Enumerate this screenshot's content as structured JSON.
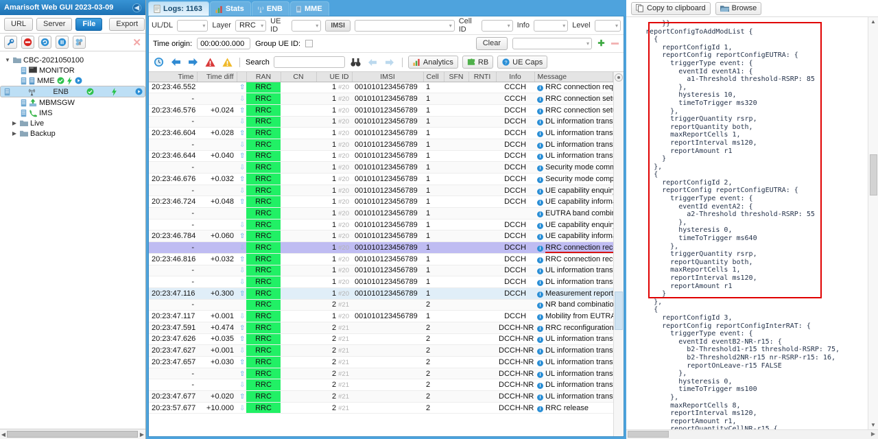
{
  "left_panel": {
    "title": "Amarisoft Web GUI 2023-03-09",
    "collapse_icon": "chevron-left-icon",
    "source_buttons": [
      {
        "label": "URL",
        "active": false
      },
      {
        "label": "Server",
        "active": false
      },
      {
        "label": "File",
        "active": true
      }
    ],
    "export_label": "Export",
    "tools": [
      "wrench-icon",
      "stop-icon",
      "refresh-icon",
      "pause-icon",
      "plug-icon",
      "close-icon"
    ],
    "tree": [
      {
        "label": "CBC-2021050100",
        "level": 0,
        "expanded": true,
        "icon": "folder-icon",
        "selected": false
      },
      {
        "label": "MONITOR",
        "level": 1,
        "icon": "monitor-icon",
        "selected": false,
        "badges": []
      },
      {
        "label": "MME",
        "level": 1,
        "icon": "server-icon",
        "selected": false,
        "badges": [
          "check",
          "bolt",
          "play"
        ]
      },
      {
        "label": "ENB",
        "level": 1,
        "icon": "antenna-icon",
        "selected": true,
        "badges": [
          "check",
          "bolt",
          "play"
        ]
      },
      {
        "label": "MBMSGW",
        "level": 1,
        "icon": "upload-icon",
        "selected": false,
        "badges": []
      },
      {
        "label": "IMS",
        "level": 1,
        "icon": "phone-icon",
        "selected": false,
        "badges": []
      },
      {
        "label": "Live",
        "level": 0,
        "expanded": false,
        "icon": "folder-icon",
        "selected": false
      },
      {
        "label": "Backup",
        "level": 0,
        "expanded": false,
        "icon": "folder-icon",
        "selected": false
      }
    ]
  },
  "tabs": [
    {
      "label": "Logs: 1163",
      "icon": "log-icon",
      "active": true
    },
    {
      "label": "Stats",
      "icon": "chart-icon",
      "active": false
    },
    {
      "label": "ENB",
      "icon": "antenna-icon",
      "active": false
    },
    {
      "label": "MME",
      "icon": "server-icon",
      "active": false
    }
  ],
  "filters": {
    "uldl_label": "UL/DL",
    "uldl_value": "",
    "layer_label": "Layer",
    "layer_value": "RRC",
    "ueid_label": "UE ID",
    "ueid_value": "",
    "imsi_label": "IMSI",
    "imsi_value": "",
    "cellid_label": "Cell ID",
    "cellid_value": "",
    "info_label": "Info",
    "info_value": "",
    "level_label": "Level",
    "level_value": ""
  },
  "filters2": {
    "time_origin_label": "Time origin:",
    "time_origin_value": "00:00:00.000",
    "group_ue_label": "Group UE ID:",
    "group_ue_checked": false,
    "clear_label": "Clear",
    "preset_value": "",
    "add_icon": "plus-icon",
    "remove_icon": "minus-icon"
  },
  "toolbar3": {
    "icons": [
      "clock-icon",
      "arrow-left-icon",
      "arrow-right-icon",
      "error-icon",
      "warning-icon"
    ],
    "search_label": "Search",
    "search_value": "",
    "search_icon": "binoculars-icon",
    "prev_icon": "arrow-left-icon",
    "next_icon": "arrow-right-icon",
    "analytics_label": "Analytics",
    "rb_label": "RB",
    "uecaps_label": "UE Caps"
  },
  "table": {
    "columns": [
      "Time",
      "Time diff",
      "",
      "RAN",
      "CN",
      "UE ID",
      "IMSI",
      "Cell",
      "SFN",
      "RNTI",
      "Info",
      "Message"
    ],
    "rows": [
      {
        "time": "20:23:46.552",
        "diff": "",
        "arrow": "up",
        "ran": "RRC",
        "cn": "",
        "ue": "1",
        "ue_sub": "#20",
        "imsi": "001010123456789",
        "cell": "1",
        "sfn": "",
        "rnti": "",
        "info": "CCCH",
        "msg": "RRC connection request",
        "style": "normal"
      },
      {
        "time": "-",
        "diff": "",
        "arrow": "dn",
        "ran": "RRC",
        "cn": "",
        "ue": "1",
        "ue_sub": "#20",
        "imsi": "001010123456789",
        "cell": "1",
        "sfn": "",
        "rnti": "",
        "info": "CCCH",
        "msg": "RRC connection setup",
        "style": "alt"
      },
      {
        "time": "20:23:46.576",
        "diff": "+0.024",
        "arrow": "up",
        "ran": "RRC",
        "cn": "",
        "ue": "1",
        "ue_sub": "#20",
        "imsi": "001010123456789",
        "cell": "1",
        "sfn": "",
        "rnti": "",
        "info": "DCCH",
        "msg": "RRC connection setup complete",
        "style": "normal"
      },
      {
        "time": "-",
        "diff": "",
        "arrow": "dn",
        "ran": "RRC",
        "cn": "",
        "ue": "1",
        "ue_sub": "#20",
        "imsi": "001010123456789",
        "cell": "1",
        "sfn": "",
        "rnti": "",
        "info": "DCCH",
        "msg": "DL information transfer",
        "style": "alt"
      },
      {
        "time": "20:23:46.604",
        "diff": "+0.028",
        "arrow": "up",
        "ran": "RRC",
        "cn": "",
        "ue": "1",
        "ue_sub": "#20",
        "imsi": "001010123456789",
        "cell": "1",
        "sfn": "",
        "rnti": "",
        "info": "DCCH",
        "msg": "UL information transfer",
        "style": "normal"
      },
      {
        "time": "-",
        "diff": "",
        "arrow": "dn",
        "ran": "RRC",
        "cn": "",
        "ue": "1",
        "ue_sub": "#20",
        "imsi": "001010123456789",
        "cell": "1",
        "sfn": "",
        "rnti": "",
        "info": "DCCH",
        "msg": "DL information transfer",
        "style": "alt"
      },
      {
        "time": "20:23:46.644",
        "diff": "+0.040",
        "arrow": "up",
        "ran": "RRC",
        "cn": "",
        "ue": "1",
        "ue_sub": "#20",
        "imsi": "001010123456789",
        "cell": "1",
        "sfn": "",
        "rnti": "",
        "info": "DCCH",
        "msg": "UL information transfer",
        "style": "normal"
      },
      {
        "time": "-",
        "diff": "",
        "arrow": "dn",
        "ran": "RRC",
        "cn": "",
        "ue": "1",
        "ue_sub": "#20",
        "imsi": "001010123456789",
        "cell": "1",
        "sfn": "",
        "rnti": "",
        "info": "DCCH",
        "msg": "Security mode command",
        "style": "alt"
      },
      {
        "time": "20:23:46.676",
        "diff": "+0.032",
        "arrow": "up",
        "ran": "RRC",
        "cn": "",
        "ue": "1",
        "ue_sub": "#20",
        "imsi": "001010123456789",
        "cell": "1",
        "sfn": "",
        "rnti": "",
        "info": "DCCH",
        "msg": "Security mode complete",
        "style": "normal"
      },
      {
        "time": "-",
        "diff": "",
        "arrow": "dn",
        "ran": "RRC",
        "cn": "",
        "ue": "1",
        "ue_sub": "#20",
        "imsi": "001010123456789",
        "cell": "1",
        "sfn": "",
        "rnti": "",
        "info": "DCCH",
        "msg": "UE capability enquiry",
        "style": "alt"
      },
      {
        "time": "20:23:46.724",
        "diff": "+0.048",
        "arrow": "up",
        "ran": "RRC",
        "cn": "",
        "ue": "1",
        "ue_sub": "#20",
        "imsi": "001010123456789",
        "cell": "1",
        "sfn": "",
        "rnti": "",
        "info": "DCCH",
        "msg": "UE capability information",
        "style": "normal"
      },
      {
        "time": "-",
        "diff": "",
        "arrow": "",
        "ran": "RRC",
        "cn": "",
        "ue": "1",
        "ue_sub": "#20",
        "imsi": "001010123456789",
        "cell": "1",
        "sfn": "",
        "rnti": "",
        "info": "",
        "msg": "EUTRA band combinations",
        "style": "alt"
      },
      {
        "time": "-",
        "diff": "",
        "arrow": "dn",
        "ran": "RRC",
        "cn": "",
        "ue": "1",
        "ue_sub": "#20",
        "imsi": "001010123456789",
        "cell": "1",
        "sfn": "",
        "rnti": "",
        "info": "DCCH",
        "msg": "UE capability enquiry",
        "style": "normal"
      },
      {
        "time": "20:23:46.784",
        "diff": "+0.060",
        "arrow": "up",
        "ran": "RRC",
        "cn": "",
        "ue": "1",
        "ue_sub": "#20",
        "imsi": "001010123456789",
        "cell": "1",
        "sfn": "",
        "rnti": "",
        "info": "DCCH",
        "msg": "UE capability information",
        "style": "alt"
      },
      {
        "time": "-",
        "diff": "",
        "arrow": "dn",
        "ran": "RRC",
        "cn": "",
        "ue": "1",
        "ue_sub": "#20",
        "imsi": "001010123456789",
        "cell": "1",
        "sfn": "",
        "rnti": "",
        "info": "DCCH",
        "msg": "RRC connection reconfiguration",
        "style": "selected"
      },
      {
        "time": "20:23:46.816",
        "diff": "+0.032",
        "arrow": "up",
        "ran": "RRC",
        "cn": "",
        "ue": "1",
        "ue_sub": "#20",
        "imsi": "001010123456789",
        "cell": "1",
        "sfn": "",
        "rnti": "",
        "info": "DCCH",
        "msg": "RRC connection reconfiguration complete",
        "style": "normal"
      },
      {
        "time": "-",
        "diff": "",
        "arrow": "dn",
        "ran": "RRC",
        "cn": "",
        "ue": "1",
        "ue_sub": "#20",
        "imsi": "001010123456789",
        "cell": "1",
        "sfn": "",
        "rnti": "",
        "info": "DCCH",
        "msg": "UL information transfer",
        "style": "alt"
      },
      {
        "time": "-",
        "diff": "",
        "arrow": "dn",
        "ran": "RRC",
        "cn": "",
        "ue": "1",
        "ue_sub": "#20",
        "imsi": "001010123456789",
        "cell": "1",
        "sfn": "",
        "rnti": "",
        "info": "DCCH",
        "msg": "DL information transfer",
        "style": "normal"
      },
      {
        "time": "20:23:47.116",
        "diff": "+0.300",
        "arrow": "up",
        "ran": "RRC",
        "cn": "",
        "ue": "1",
        "ue_sub": "#20",
        "imsi": "001010123456789",
        "cell": "1",
        "sfn": "",
        "rnti": "",
        "info": "DCCH",
        "msg": "Measurement report",
        "style": "highlight"
      },
      {
        "time": "-",
        "diff": "",
        "arrow": "",
        "ran": "RRC",
        "cn": "",
        "ue": "2",
        "ue_sub": "#21",
        "imsi": "",
        "cell": "2",
        "sfn": "",
        "rnti": "",
        "info": "",
        "msg": "NR band combinations",
        "style": "alt"
      },
      {
        "time": "20:23:47.117",
        "diff": "+0.001",
        "arrow": "dn",
        "ran": "RRC",
        "cn": "",
        "ue": "1",
        "ue_sub": "#20",
        "imsi": "001010123456789",
        "cell": "1",
        "sfn": "",
        "rnti": "",
        "info": "DCCH",
        "msg": "Mobility from EUTRA command",
        "style": "normal"
      },
      {
        "time": "20:23:47.591",
        "diff": "+0.474",
        "arrow": "up",
        "ran": "RRC",
        "cn": "",
        "ue": "2",
        "ue_sub": "#21",
        "imsi": "",
        "cell": "2",
        "sfn": "",
        "rnti": "",
        "info": "DCCH-NR",
        "msg": "RRC reconfiguration complete",
        "style": "alt"
      },
      {
        "time": "20:23:47.626",
        "diff": "+0.035",
        "arrow": "up",
        "ran": "RRC",
        "cn": "",
        "ue": "2",
        "ue_sub": "#21",
        "imsi": "",
        "cell": "2",
        "sfn": "",
        "rnti": "",
        "info": "DCCH-NR",
        "msg": "UL information transfer",
        "style": "normal"
      },
      {
        "time": "20:23:47.627",
        "diff": "+0.001",
        "arrow": "dn",
        "ran": "RRC",
        "cn": "",
        "ue": "2",
        "ue_sub": "#21",
        "imsi": "",
        "cell": "2",
        "sfn": "",
        "rnti": "",
        "info": "DCCH-NR",
        "msg": "DL information transfer",
        "style": "alt"
      },
      {
        "time": "20:23:47.657",
        "diff": "+0.030",
        "arrow": "up",
        "ran": "RRC",
        "cn": "",
        "ue": "2",
        "ue_sub": "#21",
        "imsi": "",
        "cell": "2",
        "sfn": "",
        "rnti": "",
        "info": "DCCH-NR",
        "msg": "UL information transfer",
        "style": "normal"
      },
      {
        "time": "-",
        "diff": "",
        "arrow": "up",
        "ran": "RRC",
        "cn": "",
        "ue": "2",
        "ue_sub": "#21",
        "imsi": "",
        "cell": "2",
        "sfn": "",
        "rnti": "",
        "info": "DCCH-NR",
        "msg": "UL information transfer",
        "style": "alt"
      },
      {
        "time": "-",
        "diff": "",
        "arrow": "dn",
        "ran": "RRC",
        "cn": "",
        "ue": "2",
        "ue_sub": "#21",
        "imsi": "",
        "cell": "2",
        "sfn": "",
        "rnti": "",
        "info": "DCCH-NR",
        "msg": "DL information transfer",
        "style": "normal"
      },
      {
        "time": "20:23:47.677",
        "diff": "+0.020",
        "arrow": "up",
        "ran": "RRC",
        "cn": "",
        "ue": "2",
        "ue_sub": "#21",
        "imsi": "",
        "cell": "2",
        "sfn": "",
        "rnti": "",
        "info": "DCCH-NR",
        "msg": "UL information transfer",
        "style": "alt"
      },
      {
        "time": "20:23:57.677",
        "diff": "+10.000",
        "arrow": "dn",
        "ran": "RRC",
        "cn": "",
        "ue": "2",
        "ue_sub": "#21",
        "imsi": "",
        "cell": "2",
        "sfn": "",
        "rnti": "",
        "info": "DCCH-NR",
        "msg": "RRC release",
        "style": "normal"
      }
    ]
  },
  "right_panel": {
    "copy_label": "Copy to clipboard",
    "copy_icon": "copy-icon",
    "browse_label": "Browse",
    "browse_icon": "folder-open-icon",
    "config_text": "      }}\n  reportConfigToAddModList {\n    {\n      reportConfigId 1,\n      reportConfig reportConfigEUTRA: {\n        triggerType event: {\n          eventId eventA1: {\n            a1-Threshold threshold-RSRP: 85\n          },\n          hysteresis 10,\n          timeToTrigger ms320\n        },\n        triggerQuantity rsrp,\n        reportQuantity both,\n        maxReportCells 1,\n        reportInterval ms120,\n        reportAmount r1\n      }\n    },\n    {\n      reportConfigId 2,\n      reportConfig reportConfigEUTRA: {\n        triggerType event: {\n          eventId eventA2: {\n            a2-Threshold threshold-RSRP: 55\n          },\n          hysteresis 0,\n          timeToTrigger ms640\n        },\n        triggerQuantity rsrp,\n        reportQuantity both,\n        maxReportCells 1,\n        reportInterval ms120,\n        reportAmount r1\n      }\n    },\n    {\n      reportConfigId 3,\n      reportConfig reportConfigInterRAT: {\n        triggerType event: {\n          eventId eventB2-NR-r15: {\n            b2-Threshold1-r15 threshold-RSRP: 75,\n            b2-Threshold2NR-r15 nr-RSRP-r15: 16,\n            reportOnLeave-r15 FALSE\n          },\n          hysteresis 0,\n          timeToTrigger ms100\n        },\n        maxReportCells 8,\n        reportInterval ms120,\n        reportAmount r1,\n        reportQuantityCellNR-r15 {"
  },
  "annotations": {
    "config_highlight_box_color": "#e00000",
    "message_underline_color": "#d81313"
  },
  "colors": {
    "title_bar": "#2786c8",
    "ran_cell": "#21f065",
    "selected_row": "#bfbcf2",
    "highlight_row": "#e0eef8",
    "tree_selected": "#bddff5"
  }
}
